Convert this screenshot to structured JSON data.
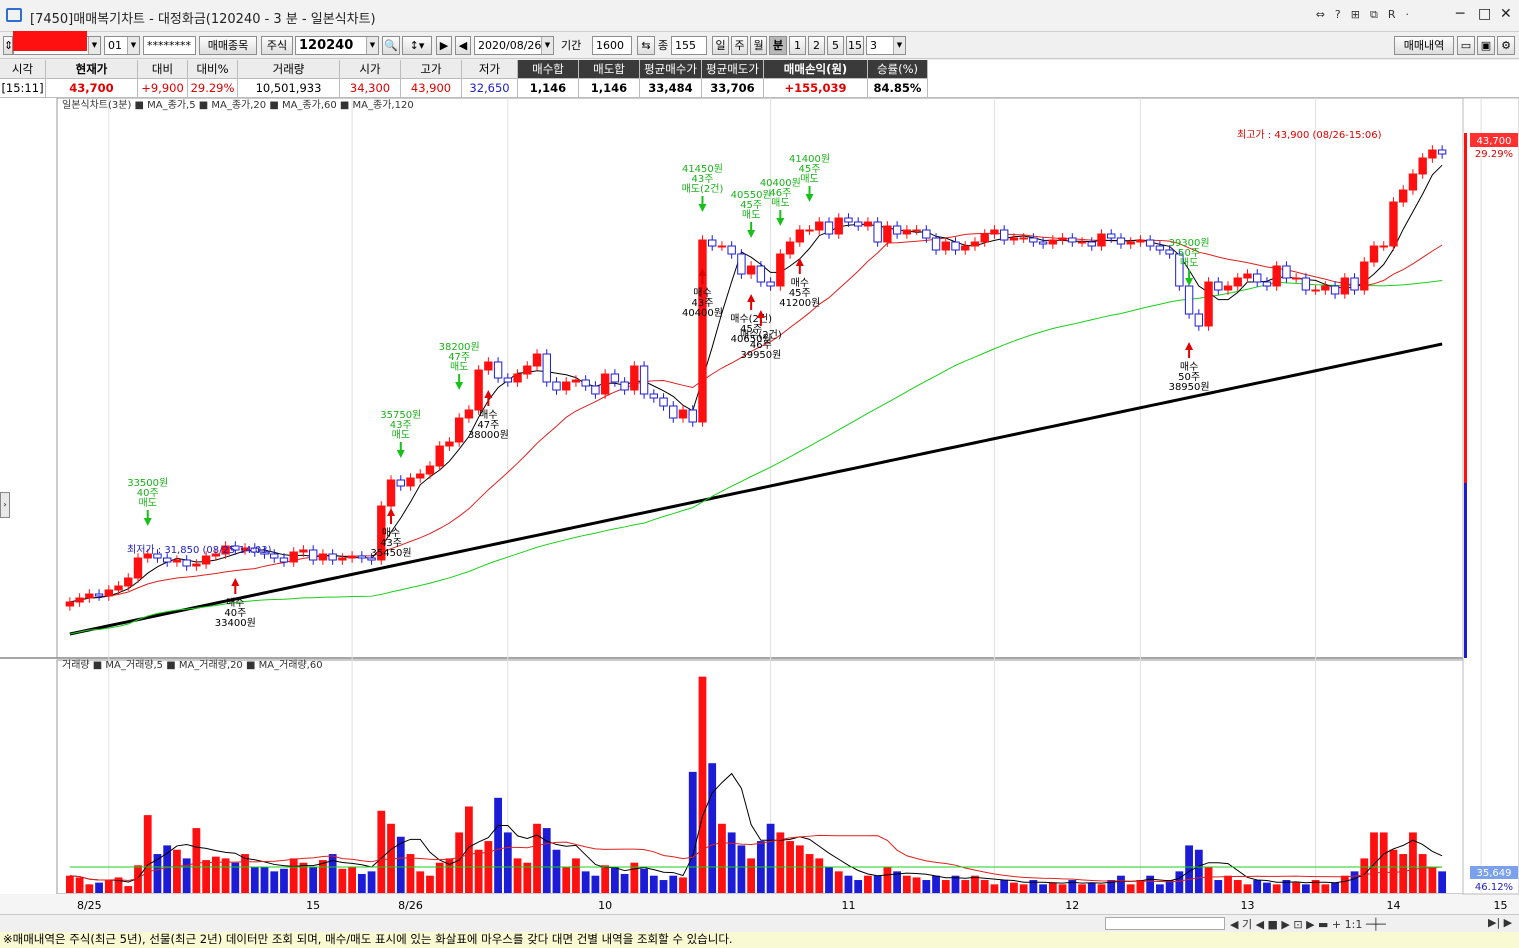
{
  "window": {
    "title": "[7450]매매복기차트 - 대정화금(120240 - 3 분 - 일본식차트)",
    "controls": [
      "⇔",
      "?",
      "⊞",
      "⧉",
      "R",
      "·",
      "─",
      "□",
      "✕"
    ]
  },
  "toolbar": {
    "account_code": "01",
    "password": "********",
    "trade_item_btn": "매매종목",
    "market_type": "주식",
    "stock_code": "120240",
    "date": "2020/08/26",
    "period_label": "기간",
    "period_value": "1600",
    "count_label": "종",
    "count_value": "155",
    "units": [
      "일",
      "주",
      "월",
      "분",
      "1",
      "2",
      "5",
      "15"
    ],
    "active_unit": "분",
    "interval_value": "3",
    "trade_history_btn": "매매내역"
  },
  "quote": {
    "headers": [
      "시각",
      "현재가",
      "대비",
      "대비%",
      "거래량",
      "시가",
      "고가",
      "저가",
      "매수합",
      "매도합",
      "평균매수가",
      "평균매도가",
      "매매손익(원)",
      "승률(%)"
    ],
    "values": [
      "[15:11]",
      "43,700",
      "+9,900",
      "29.29%",
      "10,501,933",
      "34,300",
      "43,900",
      "32,650",
      "1,146",
      "1,146",
      "33,484",
      "33,706",
      "+155,039",
      "84.85%"
    ]
  },
  "price_legend": {
    "title": "일본식차트(3분)",
    "ma5": "MA_종가,5",
    "ma20": "MA_종가,20",
    "ma60": "MA_종가,60",
    "ma120": "MA_종가,120"
  },
  "volume_legend": {
    "title": "거래량",
    "ma5": "MA_거래량,5",
    "ma20": "MA_거래량,20",
    "ma60": "MA_거래량,60"
  },
  "annotations": {
    "high_label": "최고가 : 43,900 (08/26-15:06)",
    "low_label": "최저가 : 31,850 (08/25-14:03)",
    "price_badge": "43,700",
    "change_badge": "29.29%",
    "volume_badge": "35,649",
    "volume_pct_badge": "46.12%"
  },
  "trade_marks": [
    {
      "type": "sell",
      "lines": [
        "33500원",
        "40주",
        "매도"
      ]
    },
    {
      "type": "buy",
      "lines": [
        "매수",
        "40주",
        "33400원"
      ]
    },
    {
      "type": "sell",
      "lines": [
        "35750원",
        "43주",
        "매도"
      ]
    },
    {
      "type": "buy",
      "lines": [
        "매수",
        "43주",
        "35450원"
      ]
    },
    {
      "type": "sell",
      "lines": [
        "38200원",
        "47주",
        "매도"
      ]
    },
    {
      "type": "buy",
      "lines": [
        "매수",
        "47주",
        "38000원"
      ]
    },
    {
      "type": "sell",
      "lines": [
        "41450원",
        "43주",
        "매도(2건)"
      ]
    },
    {
      "type": "buy",
      "lines": [
        "매수",
        "43주",
        "40400원"
      ]
    },
    {
      "type": "sell",
      "lines": [
        "40550원",
        "45주",
        "매도"
      ]
    },
    {
      "type": "buy",
      "lines": [
        "매수(2건)",
        "45주",
        "40650원"
      ]
    },
    {
      "type": "sell",
      "lines": [
        "40400원",
        "46주",
        "매도"
      ]
    },
    {
      "type": "buy",
      "lines": [
        "매수(2건)",
        "46주",
        "39950원"
      ]
    },
    {
      "type": "sell",
      "lines": [
        "41400원",
        "45주",
        "매도"
      ]
    },
    {
      "type": "buy",
      "lines": [
        "매수",
        "45주",
        "41200원"
      ]
    },
    {
      "type": "sell",
      "lines": [
        "39300원",
        "50주",
        "매도"
      ]
    },
    {
      "type": "buy",
      "lines": [
        "매수",
        "50주",
        "38950원"
      ]
    }
  ],
  "x_axis": [
    "8/25",
    "15",
    "8/26",
    "10",
    "11",
    "12",
    "13",
    "14",
    "15"
  ],
  "chart_data": {
    "type": "bar",
    "title": "",
    "xlabel": "",
    "ylabel": "",
    "x": [
      "8/25",
      "15",
      "8/26",
      "10",
      "11",
      "12",
      "13",
      "14",
      "15"
    ],
    "price_range": [
      31850,
      43900
    ],
    "series": [
      {
        "name": "MA_종가,5"
      },
      {
        "name": "MA_종가,20"
      },
      {
        "name": "MA_종가,60"
      },
      {
        "name": "MA_종가,120"
      }
    ],
    "close": [
      32400,
      32500,
      32600,
      32550,
      32700,
      32800,
      33000,
      33500,
      33600,
      33500,
      33400,
      33450,
      33300,
      33350,
      33550,
      33600,
      33800,
      33700,
      33750,
      33650,
      33600,
      33500,
      33400,
      33650,
      33700,
      33450,
      33600,
      33450,
      33500,
      33550,
      33500,
      33450,
      34800,
      35450,
      35300,
      35500,
      35600,
      35800,
      36300,
      36400,
      37000,
      37200,
      38200,
      38400,
      38000,
      37900,
      38100,
      38300,
      38600,
      37900,
      37700,
      37900,
      37950,
      37800,
      37600,
      38100,
      37900,
      37700,
      38300,
      37600,
      37500,
      37300,
      37000,
      37200,
      36900,
      41450,
      41300,
      41300,
      41100,
      40600,
      40800,
      40400,
      40300,
      41100,
      41400,
      41700,
      41700,
      41900,
      41600,
      42000,
      41900,
      41800,
      41900,
      41400,
      41800,
      41600,
      41700,
      41700,
      41500,
      41200,
      41400,
      41200,
      41300,
      41400,
      41600,
      41700,
      41450,
      41500,
      41500,
      41400,
      41350,
      41450,
      41500,
      41400,
      41400,
      41300,
      41600,
      41500,
      41350,
      41400,
      41450,
      41300,
      41200,
      41100,
      40300,
      39600,
      39300,
      40400,
      40200,
      40300,
      40500,
      40600,
      40400,
      40300,
      40800,
      40500,
      40500,
      40200,
      40200,
      40300,
      40100,
      40500,
      40200,
      40900,
      41300,
      41300,
      42400,
      42700,
      43100,
      43500,
      43700,
      43600
    ],
    "volume": [
      20,
      18,
      10,
      12,
      15,
      18,
      8,
      32,
      90,
      45,
      55,
      50,
      40,
      75,
      38,
      42,
      40,
      35,
      45,
      30,
      30,
      25,
      28,
      40,
      35,
      30,
      38,
      45,
      28,
      30,
      22,
      25,
      95,
      80,
      65,
      45,
      25,
      20,
      35,
      40,
      70,
      100,
      50,
      60,
      110,
      70,
      40,
      35,
      80,
      75,
      50,
      30,
      40,
      25,
      20,
      32,
      30,
      22,
      35,
      28,
      20,
      15,
      20,
      18,
      140,
      250,
      150,
      80,
      70,
      55,
      40,
      60,
      80,
      70,
      60,
      55,
      45,
      40,
      30,
      25,
      20,
      15,
      20,
      20,
      30,
      25,
      20,
      18,
      15,
      20,
      15,
      20,
      15,
      20,
      15,
      10,
      15,
      12,
      10,
      15,
      10,
      12,
      10,
      15,
      10,
      12,
      10,
      15,
      20,
      10,
      15,
      20,
      10,
      15,
      25,
      55,
      50,
      30,
      15,
      20,
      15,
      10,
      15,
      12,
      10,
      15,
      12,
      10,
      15,
      10,
      12,
      20,
      25,
      40,
      70,
      70,
      50,
      45,
      70,
      45,
      30,
      25
    ]
  }
}
